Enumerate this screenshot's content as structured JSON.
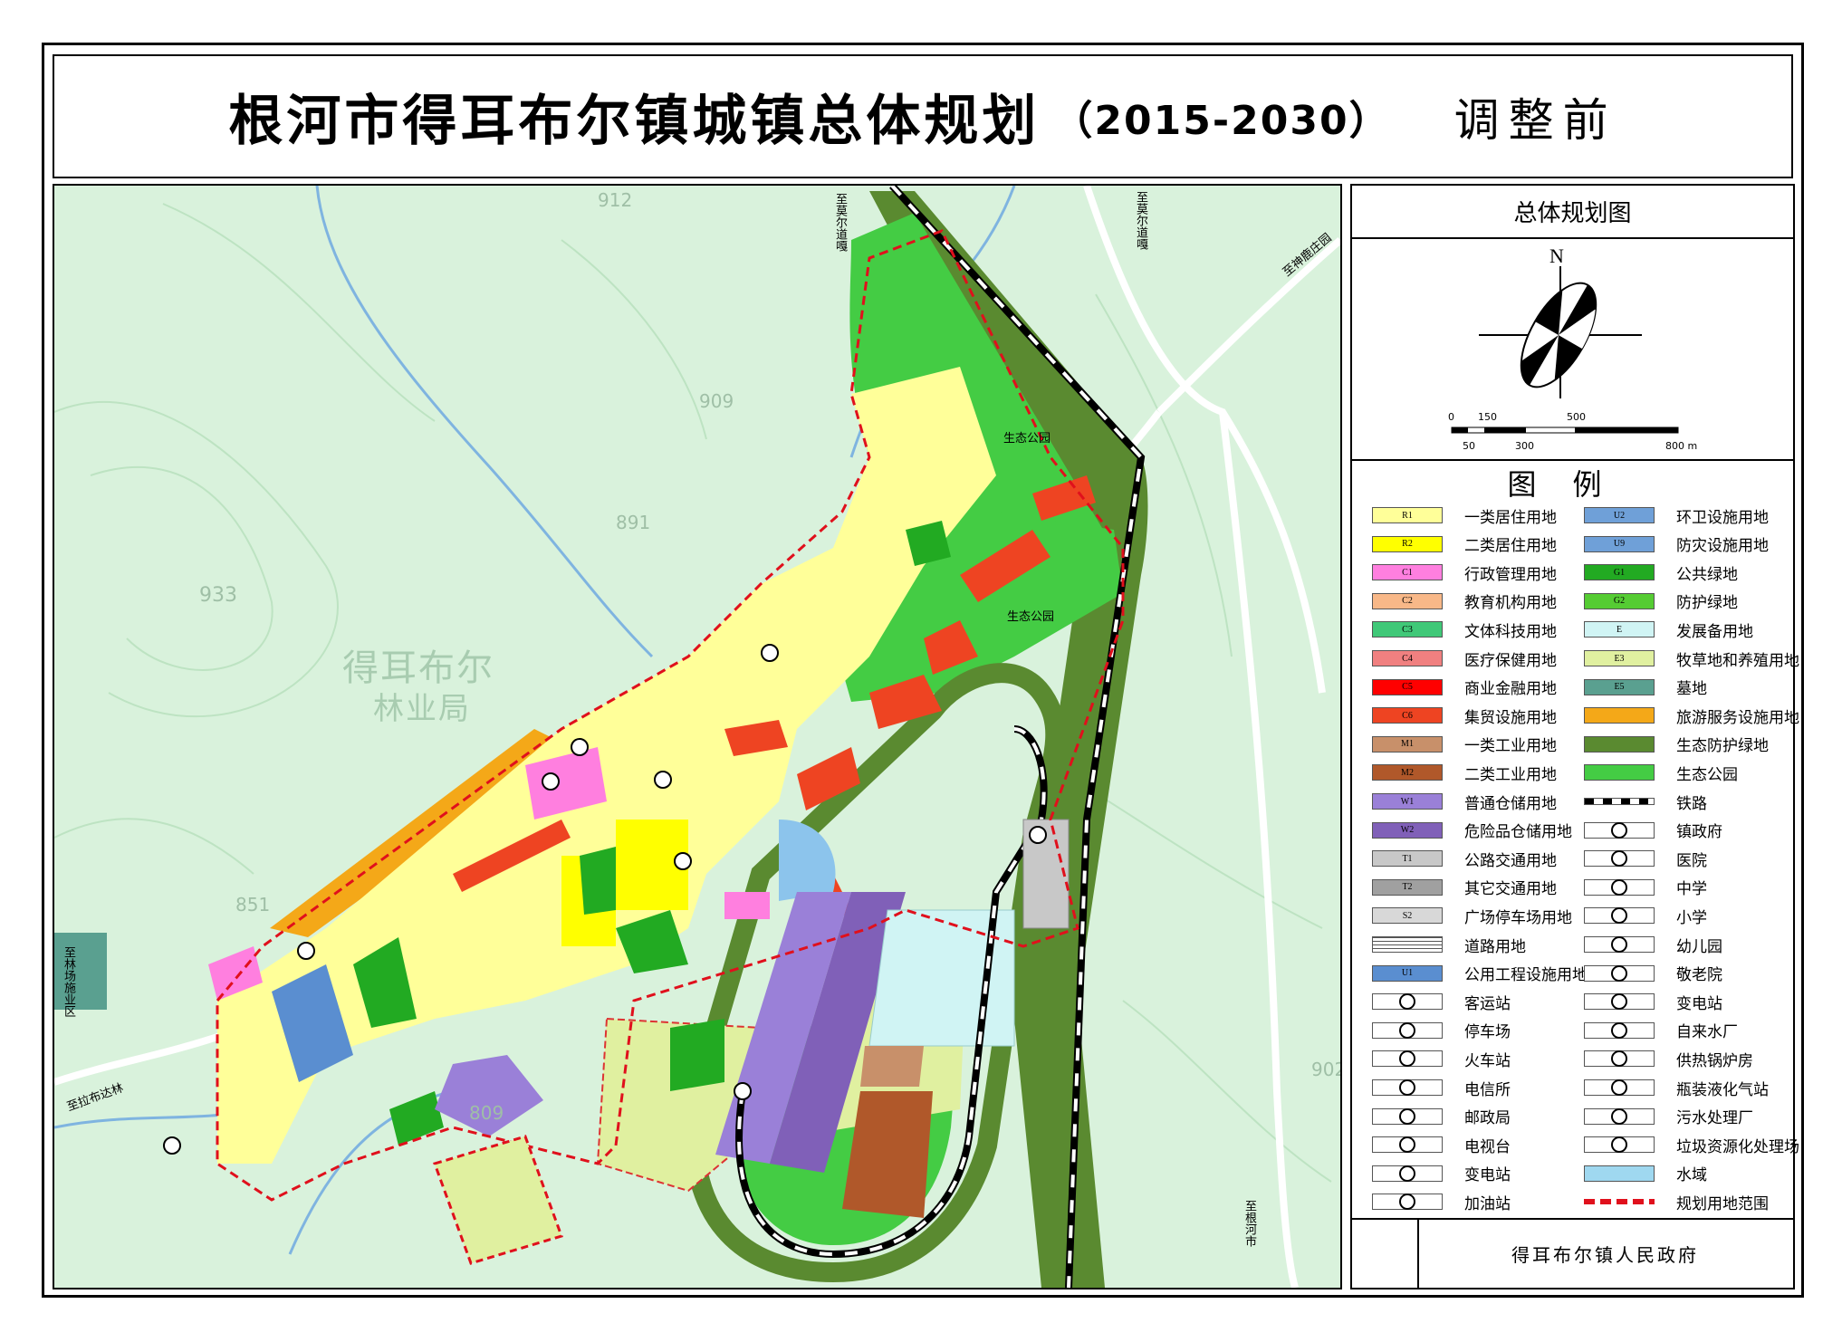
{
  "title": {
    "main": "根河市得耳布尔镇城镇总体规划",
    "years": "（2015-2030）",
    "status": "调整前"
  },
  "panel": {
    "heading": "总体规划图",
    "north": "N",
    "scale_top": [
      "0",
      "150",
      "500"
    ],
    "scale_bottom": [
      "50",
      "300",
      "800 m"
    ],
    "legend_title": "图例",
    "footer": "得耳布尔镇人民政府"
  },
  "map_labels": {
    "to_moerdaoga_1": "至莫尔道嘎",
    "to_moerdaoga_2": "至莫尔道嘎",
    "to_shenlu": "至神鹿庄园",
    "to_linchang": "至林场施业区",
    "to_labuda": "至拉布达林",
    "to_genhe": "至根河市",
    "forestry_1": "得耳布尔",
    "forestry_2": "林业局",
    "eco_park_1": "生态公园",
    "eco_park_2": "生态公园",
    "elev_912": "912",
    "elev_909": "909",
    "elev_891": "891",
    "elev_933": "933",
    "elev_851": "851",
    "elev_809": "809",
    "elev_902": "902"
  },
  "legend_left": [
    {
      "code": "R1",
      "label": "一类居住用地",
      "color": "#ffff99"
    },
    {
      "code": "R2",
      "label": "二类居住用地",
      "color": "#ffff00"
    },
    {
      "code": "C1",
      "label": "行政管理用地",
      "color": "#ff7fdf"
    },
    {
      "code": "C2",
      "label": "教育机构用地",
      "color": "#f8b888"
    },
    {
      "code": "C3",
      "label": "文体科技用地",
      "color": "#40c878"
    },
    {
      "code": "C4",
      "label": "医疗保健用地",
      "color": "#f08080"
    },
    {
      "code": "C5",
      "label": "商业金融用地",
      "color": "#ff0000"
    },
    {
      "code": "C6",
      "label": "集贸设施用地",
      "color": "#ee4422"
    },
    {
      "code": "M1",
      "label": "一类工业用地",
      "color": "#c8906a"
    },
    {
      "code": "M2",
      "label": "二类工业用地",
      "color": "#b0582a"
    },
    {
      "code": "W1",
      "label": "普通仓储用地",
      "color": "#9a80d8"
    },
    {
      "code": "W2",
      "label": "危险品仓储用地",
      "color": "#8060b8"
    },
    {
      "code": "T1",
      "label": "公路交通用地",
      "color": "#c8c8c8"
    },
    {
      "code": "T2",
      "label": "其它交通用地",
      "color": "#a0a0a0"
    },
    {
      "code": "S2",
      "label": "广场停车场用地",
      "color": "#d8d8d8"
    },
    {
      "code": "",
      "label": "道路用地",
      "color": "#ffffff"
    },
    {
      "code": "U1",
      "label": "公用工程设施用地",
      "color": "#5a8ed0"
    },
    {
      "code": "",
      "label": "客运站",
      "color": "#ffffff"
    },
    {
      "code": "",
      "label": "停车场",
      "color": "#ffffff"
    },
    {
      "code": "",
      "label": "火车站",
      "color": "#ffffff"
    },
    {
      "code": "",
      "label": "电信所",
      "color": "#ffffff"
    },
    {
      "code": "",
      "label": "邮政局",
      "color": "#ffffff"
    },
    {
      "code": "",
      "label": "电视台",
      "color": "#ffffff"
    },
    {
      "code": "",
      "label": "变电站",
      "color": "#ffffff"
    },
    {
      "code": "",
      "label": "加油站",
      "color": "#ffffff"
    }
  ],
  "legend_right": [
    {
      "code": "U2",
      "label": "环卫设施用地",
      "color": "#6fa0d8"
    },
    {
      "code": "U9",
      "label": "防灾设施用地",
      "color": "#6fa0d8"
    },
    {
      "code": "G1",
      "label": "公共绿地",
      "color": "#22aa22"
    },
    {
      "code": "G2",
      "label": "防护绿地",
      "color": "#55cc33"
    },
    {
      "code": "E",
      "label": "发展备用地",
      "color": "#d0f4f4"
    },
    {
      "code": "E3",
      "label": "牧草地和养殖用地",
      "color": "#e0f0a0"
    },
    {
      "code": "E5",
      "label": "墓地",
      "color": "#5aa090"
    },
    {
      "code": "",
      "label": "旅游服务设施用地",
      "color": "#f4a818"
    },
    {
      "code": "",
      "label": "生态防护绿地",
      "color": "#5a8a30"
    },
    {
      "code": "",
      "label": "生态公园",
      "color": "#44cc44"
    },
    {
      "code": "",
      "label": "铁路",
      "color": "#ffffff"
    },
    {
      "code": "",
      "label": "镇政府",
      "color": "#ffffff"
    },
    {
      "code": "",
      "label": "医院",
      "color": "#ffffff"
    },
    {
      "code": "",
      "label": "中学",
      "color": "#ffffff"
    },
    {
      "code": "",
      "label": "小学",
      "color": "#ffffff"
    },
    {
      "code": "",
      "label": "幼儿园",
      "color": "#ffffff"
    },
    {
      "code": "",
      "label": "敬老院",
      "color": "#ffffff"
    },
    {
      "code": "",
      "label": "变电站",
      "color": "#ffffff"
    },
    {
      "code": "",
      "label": "自来水厂",
      "color": "#ffffff"
    },
    {
      "code": "",
      "label": "供热锅炉房",
      "color": "#ffffff"
    },
    {
      "code": "",
      "label": "瓶装液化气站",
      "color": "#ffffff"
    },
    {
      "code": "",
      "label": "污水处理厂",
      "color": "#ffffff"
    },
    {
      "code": "",
      "label": "垃圾资源化处理场",
      "color": "#ffffff"
    },
    {
      "code": "",
      "label": "水域",
      "color": "#9fd8f0"
    },
    {
      "code": "",
      "label": "规划用地范围",
      "color": "#ffffff"
    }
  ]
}
